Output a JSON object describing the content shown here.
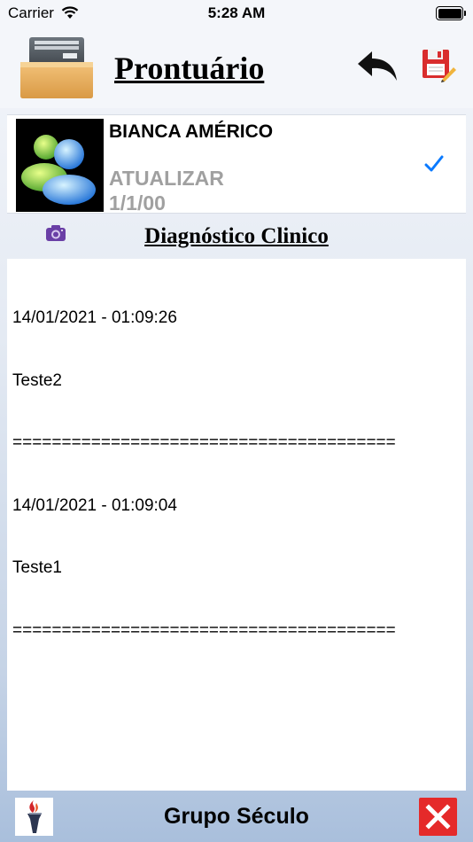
{
  "status_bar": {
    "carrier": "Carrier",
    "time": "5:28 AM"
  },
  "header": {
    "title": "Prontuário",
    "icons": {
      "drawer": "file-drawer-icon",
      "back": "back-arrow-icon",
      "save": "save-disk-icon"
    }
  },
  "patient": {
    "name": "BIANCA AMÉRICO",
    "update_label": "ATUALIZAR",
    "date": "1/1/00"
  },
  "section": {
    "title": "Diagnóstico Clinico"
  },
  "notes": [
    {
      "timestamp": "14/01/2021 - 01:09:26",
      "text": "Teste2",
      "separator": "======================================="
    },
    {
      "timestamp": "14/01/2021 - 01:09:04",
      "text": "Teste1",
      "separator": "======================================="
    }
  ],
  "footer": {
    "title": "Grupo Século"
  },
  "colors": {
    "accent": "#0a7aff",
    "close_red": "#e52a2a",
    "muted_text": "#a0a0a0"
  }
}
